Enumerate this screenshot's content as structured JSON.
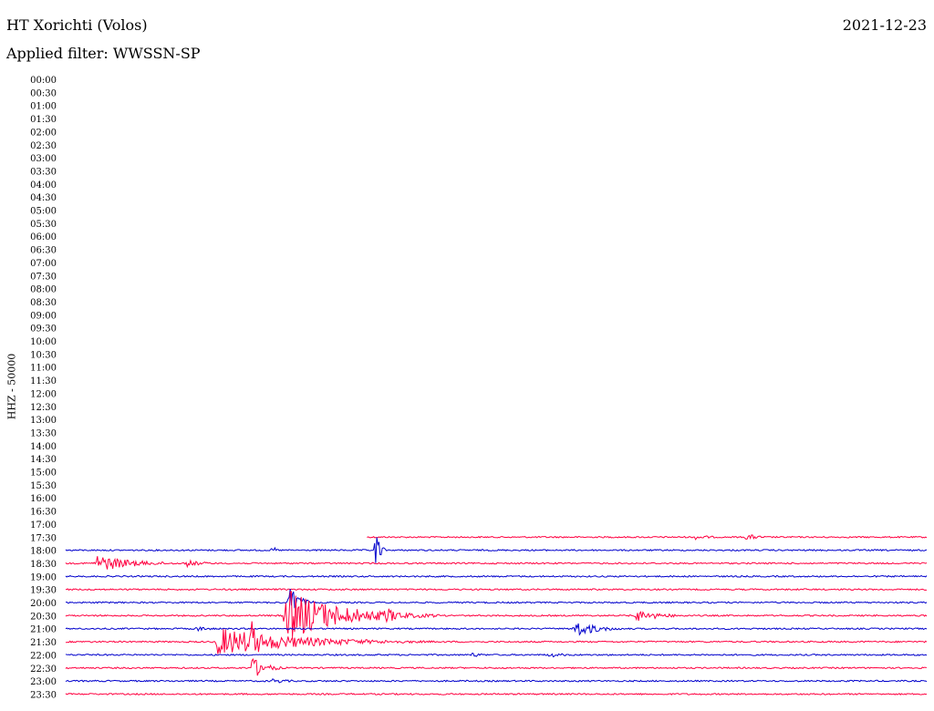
{
  "header": {
    "station": "HT Xorichti (Volos)",
    "date": "2021-12-23",
    "filter": "Applied filter: WWSSN-SP"
  },
  "chart_data": {
    "type": "line",
    "title": "HT Xorichti (Volos)",
    "ylabel": "HHZ - 50000",
    "colors": [
      "#0000cc",
      "#ff0040"
    ],
    "row_labels": [
      "00:00",
      "00:30",
      "01:00",
      "01:30",
      "02:00",
      "02:30",
      "03:00",
      "03:30",
      "04:00",
      "04:30",
      "05:00",
      "05:30",
      "06:00",
      "06:30",
      "07:00",
      "07:30",
      "08:00",
      "08:30",
      "09:00",
      "09:30",
      "10:00",
      "10:30",
      "11:00",
      "11:30",
      "12:00",
      "12:30",
      "13:00",
      "13:30",
      "14:00",
      "14:30",
      "15:00",
      "15:30",
      "16:00",
      "16:30",
      "17:00",
      "17:30",
      "18:00",
      "18:30",
      "19:00",
      "19:30",
      "20:00",
      "20:30",
      "21:00",
      "21:30",
      "22:00",
      "22:30",
      "23:00",
      "23:30"
    ],
    "traces": [
      {
        "row": "17:30",
        "color": "#ff0040",
        "start": 0.35,
        "events": [
          {
            "t": 0.73,
            "amp": 3,
            "dur": 0.02
          },
          {
            "t": 0.79,
            "amp": 4,
            "dur": 0.015
          }
        ]
      },
      {
        "row": "18:00",
        "color": "#0000cc",
        "start": 0,
        "events": [
          {
            "t": 0.24,
            "amp": 6,
            "dur": 0.004
          },
          {
            "t": 0.36,
            "amp": 30,
            "dur": 0.004
          }
        ]
      },
      {
        "row": "18:30",
        "color": "#ff0040",
        "start": 0,
        "events": [
          {
            "t": 0.035,
            "amp": 10,
            "dur": 0.04
          },
          {
            "t": 0.14,
            "amp": 4,
            "dur": 0.02
          }
        ]
      },
      {
        "row": "19:00",
        "color": "#0000cc",
        "start": 0,
        "events": []
      },
      {
        "row": "19:30",
        "color": "#ff0040",
        "start": 0,
        "events": []
      },
      {
        "row": "20:00",
        "color": "#0000cc",
        "start": 0,
        "events": [
          {
            "t": 0.26,
            "amp": 22,
            "dur": 0.01
          }
        ]
      },
      {
        "row": "20:30",
        "color": "#ff0040",
        "start": 0,
        "events": [
          {
            "t": 0.255,
            "amp": 30,
            "dur": 0.06
          },
          {
            "t": 0.33,
            "amp": 6,
            "dur": 0.04
          },
          {
            "t": 0.37,
            "amp": 10,
            "dur": 0.02
          },
          {
            "t": 0.66,
            "amp": 7,
            "dur": 0.03
          }
        ]
      },
      {
        "row": "21:00",
        "color": "#0000cc",
        "start": 0,
        "events": [
          {
            "t": 0.15,
            "amp": 3,
            "dur": 0.02
          },
          {
            "t": 0.59,
            "amp": 10,
            "dur": 0.025
          }
        ]
      },
      {
        "row": "21:30",
        "color": "#ff0040",
        "start": 0,
        "events": [
          {
            "t": 0.175,
            "amp": 16,
            "dur": 0.09
          },
          {
            "t": 0.215,
            "amp": 28,
            "dur": 0.01
          }
        ]
      },
      {
        "row": "22:00",
        "color": "#0000cc",
        "start": 0,
        "events": [
          {
            "t": 0.47,
            "amp": 3,
            "dur": 0.015
          },
          {
            "t": 0.56,
            "amp": 3,
            "dur": 0.02
          }
        ]
      },
      {
        "row": "22:30",
        "color": "#ff0040",
        "start": 0,
        "events": [
          {
            "t": 0.215,
            "amp": 14,
            "dur": 0.015
          }
        ]
      },
      {
        "row": "23:00",
        "color": "#0000cc",
        "start": 0,
        "events": [
          {
            "t": 0.24,
            "amp": 3,
            "dur": 0.02
          }
        ]
      },
      {
        "row": "23:30",
        "color": "#ff0040",
        "start": 0,
        "events": [
          {
            "t": 0.34,
            "amp": 2,
            "dur": 0.004
          }
        ]
      }
    ]
  }
}
